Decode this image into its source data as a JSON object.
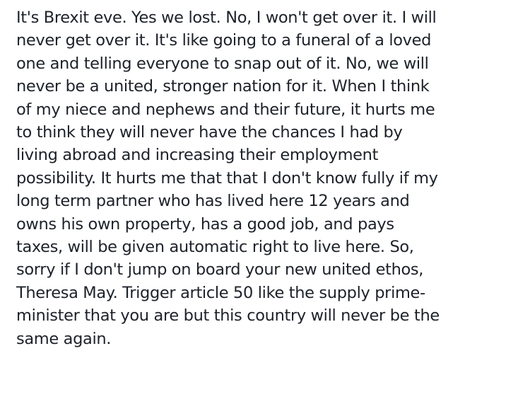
{
  "post": {
    "lines": [
      "It's Brexit eve. Yes we lost. No, I won't get over it. I will",
      "never get over it. It's like going to a funeral of a loved",
      "one and telling everyone to snap out of it. No, we will",
      "never be a united, stronger nation for it. When I think",
      "of my niece and nephews and their future, it hurts me",
      "to think they will never have the chances I had by",
      "living abroad and increasing their employment",
      "possibility. It hurts me that that I don't know fully if my",
      "long term partner who has lived here 12 years and",
      "owns his own property, has a good job, and pays",
      "taxes, will be given automatic right to live here. So,",
      "sorry if I don't jump on board your new united ethos,",
      "Theresa May. Trigger article 50 like the supply prime-",
      "minister that you are but this country will never be the",
      "same again."
    ]
  },
  "colors": {
    "text": "#1d2129",
    "background": "#ffffff"
  }
}
